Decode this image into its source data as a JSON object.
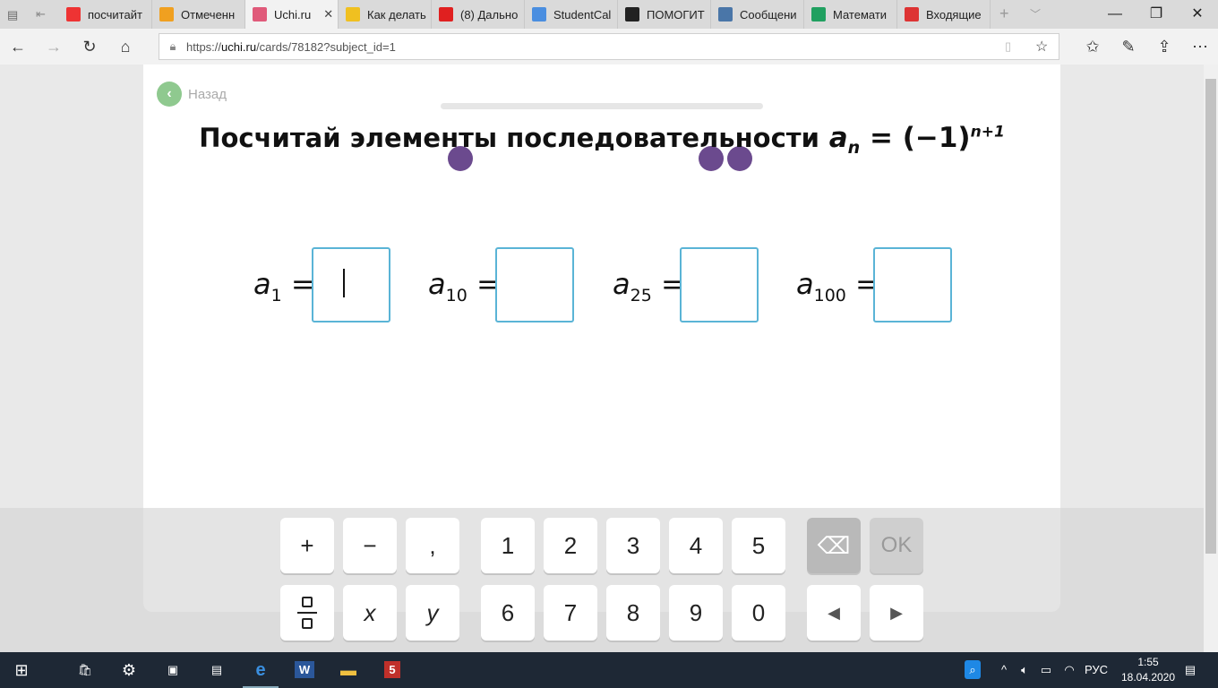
{
  "browser": {
    "tabs": [
      {
        "label": "посчитайт",
        "icon": "yandex-icon",
        "color": "#e33"
      },
      {
        "label": "Отмеченн",
        "icon": "fs-icon",
        "color": "#f0a020"
      },
      {
        "label": "Uchi.ru",
        "icon": "uchi-icon",
        "color": "#e05a7a",
        "active": true
      },
      {
        "label": "Как делать",
        "icon": "image-icon",
        "color": "#f0c020"
      },
      {
        "label": "(8) Дально",
        "icon": "youtube-icon",
        "color": "#e02020"
      },
      {
        "label": "StudentCal",
        "icon": "s-icon",
        "color": "#4a8ee0"
      },
      {
        "label": "ПОМОГИТ",
        "icon": "znanija-icon",
        "color": "#222"
      },
      {
        "label": "Сообщени",
        "icon": "vk-icon",
        "color": "#4a76a8"
      },
      {
        "label": "Математи",
        "icon": "drive-icon",
        "color": "#20a060"
      },
      {
        "label": "Входящие",
        "icon": "gmail-icon",
        "color": "#d33"
      }
    ],
    "url_prefix": "https://",
    "url_host": "uchi.ru",
    "url_path": "/cards/78182?subject_id=1"
  },
  "page": {
    "back_label": "Назад",
    "progress_steps": 3,
    "title_text": "Посчитай элементы последовательности",
    "formula": {
      "var": "a",
      "sub": "n",
      "eq": "= (−1)",
      "sup": "n+1"
    },
    "fields": [
      {
        "var": "a",
        "sub": "1",
        "value": ""
      },
      {
        "var": "a",
        "sub": "10",
        "value": ""
      },
      {
        "var": "a",
        "sub": "25",
        "value": ""
      },
      {
        "var": "a",
        "sub": "100",
        "value": ""
      }
    ],
    "eq": "="
  },
  "keyboard": {
    "row1": [
      "+",
      "−",
      ",",
      "1",
      "2",
      "3",
      "4",
      "5"
    ],
    "row2": [
      "x",
      "y",
      "6",
      "7",
      "8",
      "9",
      "0"
    ],
    "ok": "OK",
    "left": "◀",
    "right": "▶"
  },
  "taskbar": {
    "lang": "РУС",
    "time": "1:55",
    "date": "18.04.2020"
  }
}
